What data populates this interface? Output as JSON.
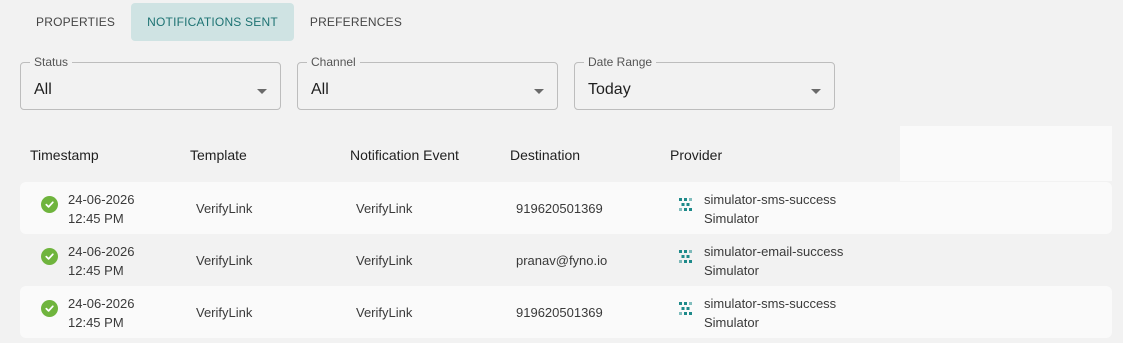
{
  "tabs": [
    {
      "label": "PROPERTIES"
    },
    {
      "label": "NOTIFICATIONS SENT"
    },
    {
      "label": "PREFERENCES"
    }
  ],
  "filters": {
    "status": {
      "label": "Status",
      "value": "All"
    },
    "channel": {
      "label": "Channel",
      "value": "All"
    },
    "date_range": {
      "label": "Date Range",
      "value": "Today"
    }
  },
  "table": {
    "columns": [
      "Timestamp",
      "Template",
      "Notification Event",
      "Destination",
      "Provider"
    ],
    "rows": [
      {
        "date": "24-06-2026",
        "time": "12:45 PM",
        "template": "VerifyLink",
        "event": "VerifyLink",
        "destination": "919620501369",
        "provider": "simulator-sms-success",
        "provider_type": "Simulator"
      },
      {
        "date": "24-06-2026",
        "time": "12:45 PM",
        "template": "VerifyLink",
        "event": "VerifyLink",
        "destination": "pranav@fyno.io",
        "provider": "simulator-email-success",
        "provider_type": "Simulator"
      },
      {
        "date": "24-06-2026",
        "time": "12:45 PM",
        "template": "VerifyLink",
        "event": "VerifyLink",
        "destination": "919620501369",
        "provider": "simulator-sms-success",
        "provider_type": "Simulator"
      }
    ]
  },
  "colors": {
    "accent": "#1e7373",
    "tab_active_bg": "#cfe3e3",
    "success": "#6fb43d",
    "provider_icon": "#1e8a8a"
  },
  "icons": {
    "status": "success-check-icon",
    "provider": "simulator-provider-icon",
    "dropdown": "chevron-down-icon"
  }
}
